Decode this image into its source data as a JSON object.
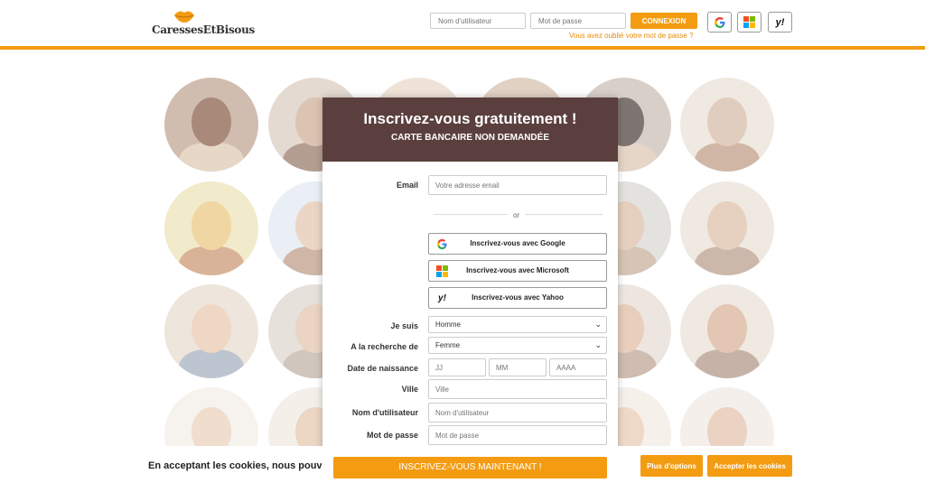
{
  "header": {
    "logo_text": "CaressesEtBisous",
    "username_placeholder": "Nom d'utilisateur",
    "password_placeholder": "Mot de passe",
    "login_label": "CONNEXION",
    "forgot_password": "Vous avez oublié votre mot de passe ?",
    "sso_icons": [
      "google-icon",
      "microsoft-icon",
      "yahoo-icon"
    ],
    "yahoo_glyph": "y!"
  },
  "modal": {
    "title": "Inscrivez-vous gratuitement !",
    "subtitle": "CARTE BANCAIRE NON DEMANDÉE",
    "email_label": "Email",
    "email_placeholder": "Votre adresse email",
    "or_text": "or",
    "google_label": "Inscrivez-vous avec Google",
    "microsoft_label": "Inscrivez-vous avec Microsoft",
    "yahoo_label": "Inscrivez-vous avec Yahoo",
    "yahoo_glyph": "y!",
    "gender_label": "Je suis",
    "gender_value": "Homme",
    "seeking_label": "A la recherche de",
    "seeking_value": "Femme",
    "birthdate_label": "Date de naissance",
    "day_placeholder": "JJ",
    "month_placeholder": "MM",
    "year_placeholder": "AAAA",
    "city_label": "Ville",
    "city_placeholder": "Ville",
    "username_label": "Nom d'utilisateur",
    "username_placeholder": "Nom d'utilisateur",
    "password_label": "Mot de passe",
    "password_placeholder": "Mot de passe",
    "submit_label": "INSCRIVEZ-VOUS MAINTENANT !"
  },
  "cookies": {
    "text": "En acceptant les cookies, nous pouvons",
    "more_options": "Plus d'options",
    "accept": "Accepter les cookies"
  },
  "colors": {
    "accent": "#f39c12",
    "modal_header": "#5b3f3e"
  }
}
